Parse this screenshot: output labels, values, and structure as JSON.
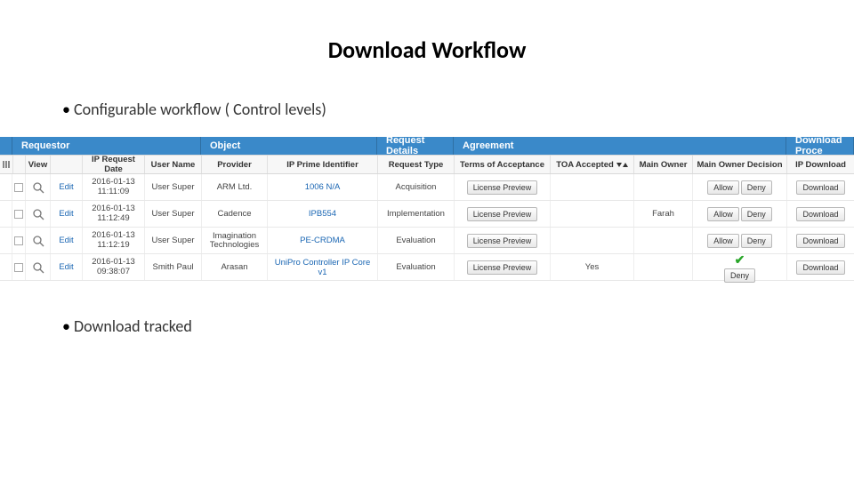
{
  "title": "Download  Workflow",
  "bullet1": "Configurable workflow ( Control levels)",
  "bullet2": "Download tracked",
  "top": {
    "requestor": "Requestor",
    "object": "Object",
    "details": "Request Details",
    "agreement": "Agreement",
    "dlproc": "Download Proce"
  },
  "hdr": {
    "view": "View",
    "date": "IP Request Date",
    "user": "User Name",
    "provider": "Provider",
    "ident": "IP Prime Identifier",
    "type": "Request Type",
    "toa": "Terms of Acceptance",
    "toaacc": "TOA Accepted",
    "mainowner": "Main Owner",
    "maindec": "Main Owner Decision",
    "dl": "IP Download"
  },
  "btn": {
    "edit": "Edit",
    "licprev": "License Preview",
    "allow": "Allow",
    "deny": "Deny",
    "download": "Download"
  },
  "rows": [
    {
      "date1": "2016-01-13",
      "date2": "11:11:09",
      "user": "User Super",
      "provider": "ARM Ltd.",
      "ident": "1006 N/A",
      "type": "Acquisition",
      "toaacc": "",
      "mainowner": "",
      "allowed": "both"
    },
    {
      "date1": "2016-01-13",
      "date2": "11:12:49",
      "user": "User Super",
      "provider": "Cadence",
      "ident": "IPB554",
      "type": "Implementation",
      "toaacc": "",
      "mainowner": "Farah",
      "allowed": "both"
    },
    {
      "date1": "2016-01-13",
      "date2": "11:12:19",
      "user": "User Super",
      "provider": "Imagination Technologies",
      "ident": "PE-CRDMA",
      "type": "Evaluation",
      "toaacc": "",
      "mainowner": "",
      "allowed": "both"
    },
    {
      "date1": "2016-01-13",
      "date2": "09:38:07",
      "user": "Smith Paul",
      "provider": "Arasan",
      "ident": "UniPro Controller IP Core v1",
      "type": "Evaluation",
      "toaacc": "Yes",
      "mainowner": "",
      "allowed": "denyonly"
    }
  ]
}
